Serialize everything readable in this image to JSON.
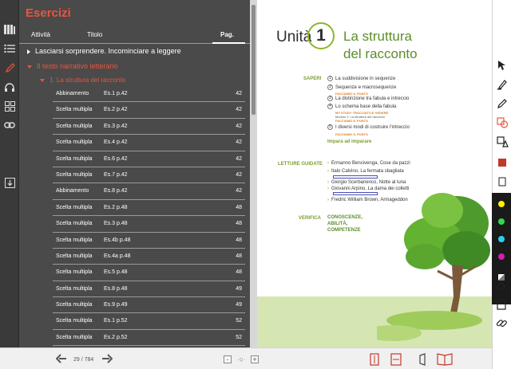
{
  "panel": {
    "title": "Esercizi",
    "columns": {
      "activity": "Attività",
      "title": "Titolo",
      "page": "Pag."
    },
    "tree": [
      {
        "label": "Lasciarsi sorprendere. Incominciare a leggere",
        "state": "collapsed"
      },
      {
        "label": "Il testo narrativo letterario",
        "state": "expanded"
      },
      {
        "label": "1. La struttura del racconto",
        "state": "expanded"
      }
    ],
    "rows": [
      {
        "type": "Abbinamento",
        "exercise": "Es.1 p.42",
        "page": "42"
      },
      {
        "type": "Scelta multipla",
        "exercise": "Es.2 p.42",
        "page": "42"
      },
      {
        "type": "Scelta multipla",
        "exercise": "Es.3 p.42",
        "page": "42"
      },
      {
        "type": "Scelta multipla",
        "exercise": "Es.4 p.42",
        "page": "42"
      },
      {
        "type": "Scelta multipla",
        "exercise": "Es.6 p.42",
        "page": "42"
      },
      {
        "type": "Scelta multipla",
        "exercise": "Es.7 p.42",
        "page": "42"
      },
      {
        "type": "Abbinamento",
        "exercise": "Es.8 p.42",
        "page": "42"
      },
      {
        "type": "Scelta multipla",
        "exercise": "Es.2 p.48",
        "page": "48"
      },
      {
        "type": "Scelta multipla",
        "exercise": "Es.3 p.48",
        "page": "48"
      },
      {
        "type": "Scelta multipla",
        "exercise": "Es.4b p.48",
        "page": "48"
      },
      {
        "type": "Scelta multipla",
        "exercise": "Es.4a p.48",
        "page": "48"
      },
      {
        "type": "Scelta multipla",
        "exercise": "Es.5 p.48",
        "page": "48"
      },
      {
        "type": "Scelta multipla",
        "exercise": "Es.8 p.48",
        "page": "49"
      },
      {
        "type": "Scelta multipla",
        "exercise": "Es.9 p.49",
        "page": "49"
      },
      {
        "type": "Scelta multipla",
        "exercise": "Es.1 p.52",
        "page": "52"
      },
      {
        "type": "Scelta multipla",
        "exercise": "Es.2 p.52",
        "page": "52"
      }
    ]
  },
  "book": {
    "unit_word": "Unità",
    "unit_number": "1",
    "title_line1": "La struttura",
    "title_line2": "del racconto",
    "saperi_label": "SAPERI",
    "saperi_items": [
      {
        "n": "1",
        "text": "La suddivisione in sequenze"
      },
      {
        "n": "2",
        "text": "Sequenze e macrosequenze"
      },
      {
        "n": "3",
        "text": "La distinzione tra fabula e intreccio"
      },
      {
        "n": "4",
        "text": "Lo schema base della fabula"
      },
      {
        "n": "5",
        "text": "I diversi modi di costruire l'intreccio"
      }
    ],
    "saperi_tags": {
      "tag1": "FACCIAMO IL PUNTO",
      "tag2a": "MY STUDY TRACCIATO E VEDERE",
      "tag2b": "Modulo 2: La struttura del racconto",
      "tag2c": "FACCIAMO IL PUNTO",
      "tag3": "FACCIAMO IL PUNTO"
    },
    "impara": "Impara ad imparare",
    "letture_label": "LETTURE GUIDATE",
    "letture": [
      "Ermanno Bencivenga, Cose da pazzi",
      "Italo Calvino, La fermata sbagliata",
      "Giorgio Scerbanenco, Notte al luna",
      "Giovanni Arpino, La dama dei colletti",
      "Fredric William Brown, Armageddon"
    ],
    "verifica_label": "VERIFICA",
    "verifica_text": [
      "CONOSCENZE,",
      "ABILITÀ,",
      "COMPETENZE"
    ]
  },
  "bottom": {
    "page_counter": "29 / 784",
    "zoom_label": "- Q -"
  },
  "colors": {
    "accent": "#e8553f",
    "green": "#5b8f2a",
    "panel_bg": "#4a4a4a"
  },
  "tool_colors": [
    "#fff200",
    "#39d353",
    "#2ad0f0",
    "#d21fb0"
  ]
}
